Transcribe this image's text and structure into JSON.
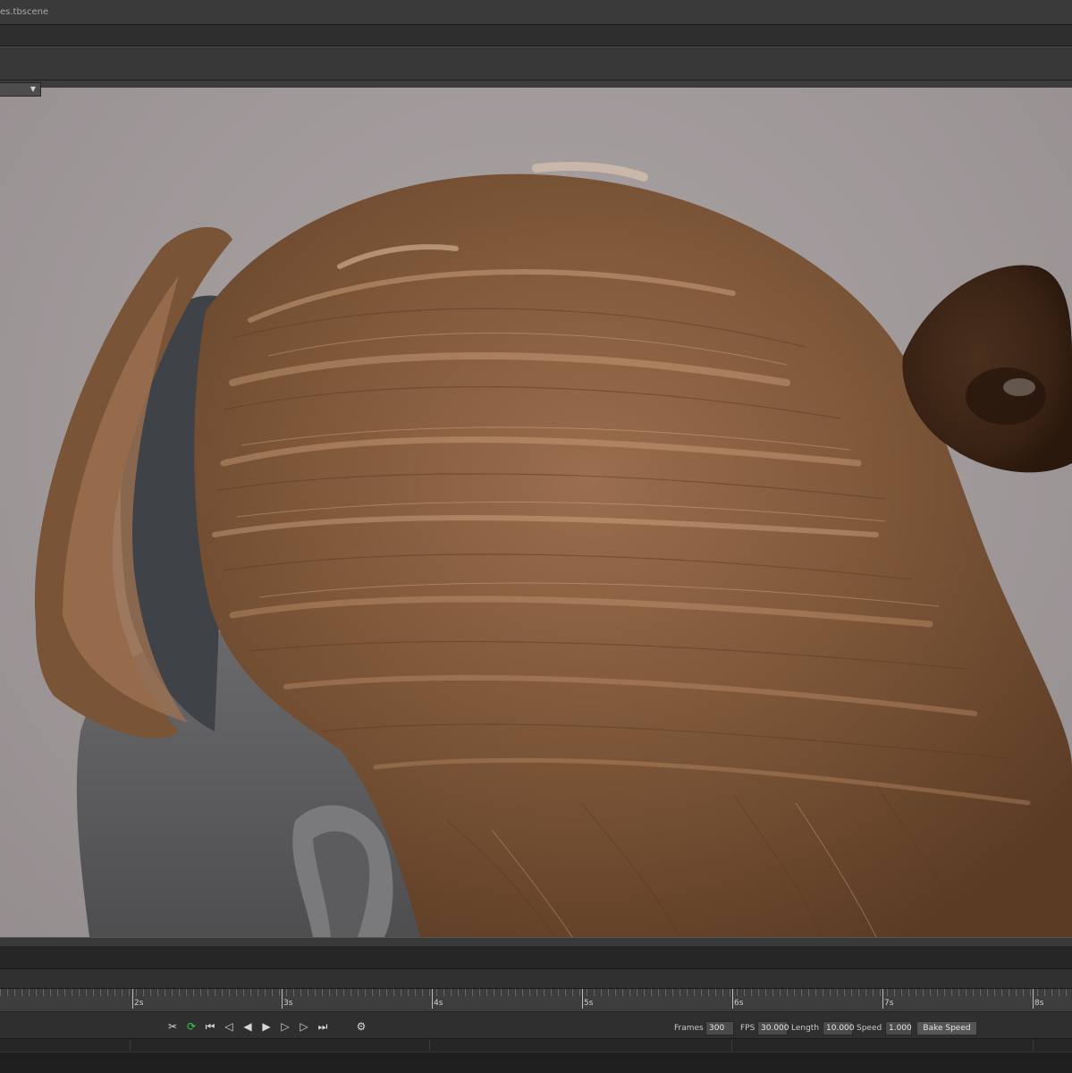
{
  "window": {
    "title": "es.tbscene"
  },
  "viewport": {
    "camera_dropdown_icon": "chevron-down-icon"
  },
  "timeline": {
    "ticks": [
      "2s",
      "3s",
      "4s",
      "5s",
      "6s",
      "7s",
      "8s"
    ]
  },
  "playback": {
    "icons": [
      "scissors-icon",
      "loop-icon",
      "skip-to-start-icon",
      "prev-key-icon",
      "step-back-icon",
      "play-icon",
      "step-forward-icon",
      "next-key-icon",
      "skip-to-end-icon",
      "settings-icon"
    ],
    "loop_color": "#2fd24a"
  },
  "settings": {
    "frames_label": "Frames",
    "frames_value": "300",
    "fps_label": "FPS",
    "fps_value": "30.000",
    "length_label": "Length",
    "length_value": "10.000",
    "speed_label": "Speed",
    "speed_value": "1.000",
    "bake_speed_label": "Bake Speed"
  }
}
